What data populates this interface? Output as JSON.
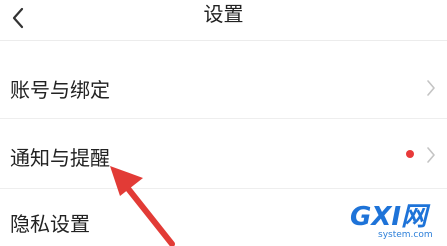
{
  "header": {
    "title": "设置",
    "back_icon": "chevron-left-icon"
  },
  "settings": {
    "items": [
      {
        "label": "账号与绑定",
        "icon": "chevron-right-icon"
      },
      {
        "label": "通知与提醒",
        "icon": "chevron-right-icon",
        "badge_icon": "red-dot-icon"
      },
      {
        "label": "隐私设置"
      }
    ]
  },
  "annotation": {
    "icon": "red-arrow-icon",
    "color": "#e23b36"
  },
  "watermark": {
    "main": "GXI网",
    "sub": "system.com"
  },
  "colors": {
    "badge": "#e83a3a",
    "chevron": "#c4c4c4",
    "text": "#222222"
  }
}
